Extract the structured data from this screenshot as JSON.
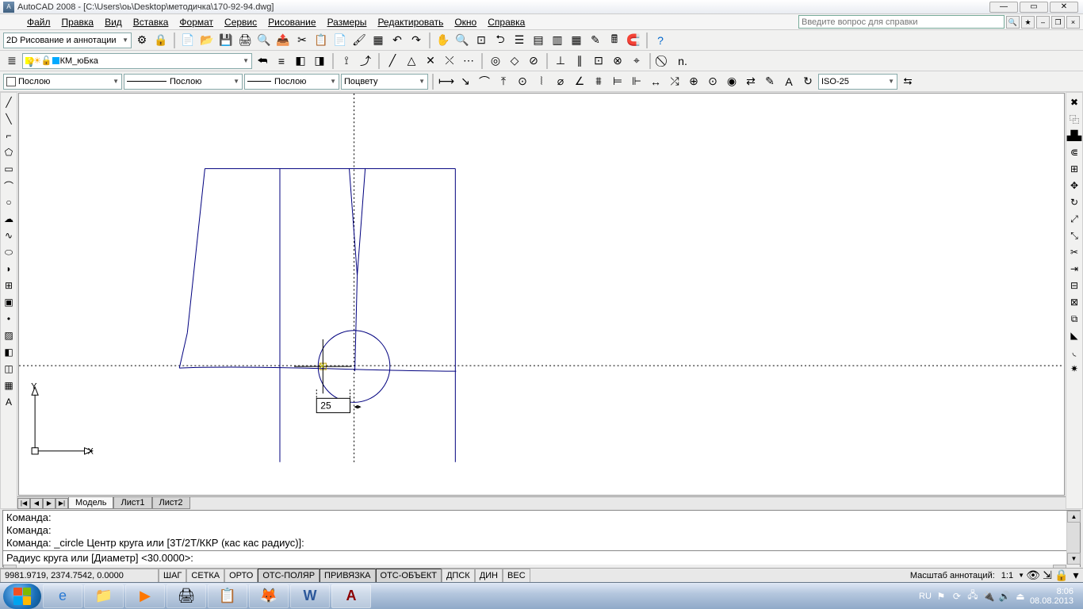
{
  "title": "AutoCAD 2008 - [C:\\Users\\оь\\Desktop\\методичка\\170-92-94.dwg]",
  "menu": [
    "Файл",
    "Правка",
    "Вид",
    "Вставка",
    "Формат",
    "Сервис",
    "Рисование",
    "Размеры",
    "Редактировать",
    "Окно",
    "Справка"
  ],
  "help_placeholder": "Введите вопрос для справки",
  "workspace_dd": "2D Рисование и аннотации",
  "layer_dd": "КМ_юБка",
  "bylayer": "Послою",
  "bycolor": "Поцвету",
  "dimstyle": "ISO-25",
  "sheet_tabs": {
    "nav": [
      "|◀",
      "◀",
      "▶",
      "▶|"
    ],
    "tabs": [
      "Модель",
      "Лист1",
      "Лист2"
    ],
    "active": 0
  },
  "cmd": {
    "lines": [
      "Команда:",
      "Команда:",
      "Команда: _circle Центр круга или [3T/2T/ККР (кас кас радиус)]:"
    ],
    "prompt": "Радиус круга или [Диаметр] <30.0000>:"
  },
  "tooltip_value": "25",
  "status": {
    "coords": "9981.9719, 2374.7542, 0.0000",
    "toggles": [
      "ШАГ",
      "СЕТКА",
      "ОРТО",
      "ОТС-ПОЛЯР",
      "ПРИВЯЗКА",
      "ОТС-ОБЪЕКТ",
      "ДПСК",
      "ДИН",
      "ВЕС"
    ],
    "pressed": [
      3,
      4,
      5
    ],
    "scale_label": "Масштаб аннотаций:",
    "scale_value": "1:1"
  },
  "tray": {
    "lang": "RU",
    "time": "8:06",
    "date": "08.08.2013"
  },
  "ucs": {
    "x": "X",
    "y": "Y"
  }
}
